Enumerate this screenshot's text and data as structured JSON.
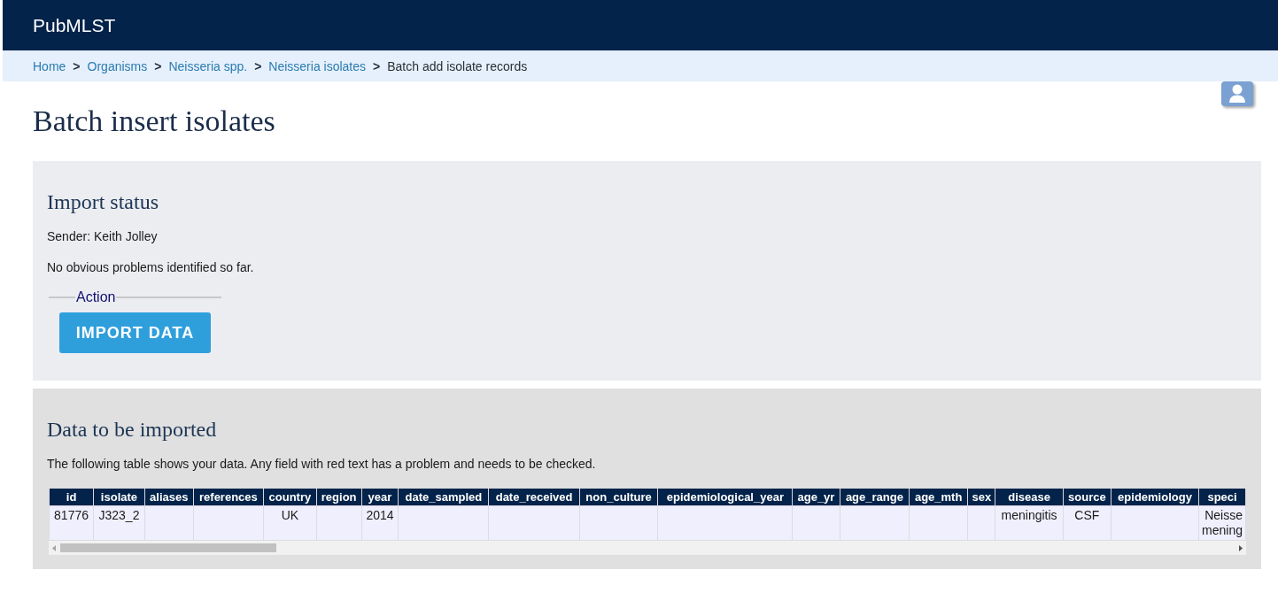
{
  "header": {
    "title": "PubMLST"
  },
  "breadcrumb": {
    "separator": ">",
    "items": [
      {
        "label": "Home",
        "current": false
      },
      {
        "label": "Organisms",
        "current": false
      },
      {
        "label": "Neisseria spp.",
        "current": false
      },
      {
        "label": "Neisseria isolates",
        "current": false
      },
      {
        "label": "Batch add isolate records",
        "current": true
      }
    ]
  },
  "page_title": "Batch insert isolates",
  "import_status": {
    "heading": "Import status",
    "sender": "Sender: Keith Jolley",
    "message": "No obvious problems identified so far.",
    "action": {
      "legend": "Action",
      "button": "IMPORT DATA"
    }
  },
  "data_section": {
    "heading": "Data to be imported",
    "description": "The following table shows your data. Any field with red text has a problem and needs to be checked.",
    "table": {
      "columns": [
        "id",
        "isolate",
        "aliases",
        "references",
        "country",
        "region",
        "year",
        "date_sampled",
        "date_received",
        "non_culture",
        "epidemiological_year",
        "age_yr",
        "age_range",
        "age_mth",
        "sex",
        "disease",
        "source",
        "epidemiology",
        "speci"
      ],
      "rows": [
        {
          "cells": [
            "81776",
            "J323_2",
            null,
            null,
            "UK",
            null,
            "2014",
            null,
            null,
            null,
            null,
            null,
            null,
            null,
            null,
            "meningitis",
            "CSF",
            null,
            "Neisse mening"
          ]
        }
      ]
    }
  }
}
